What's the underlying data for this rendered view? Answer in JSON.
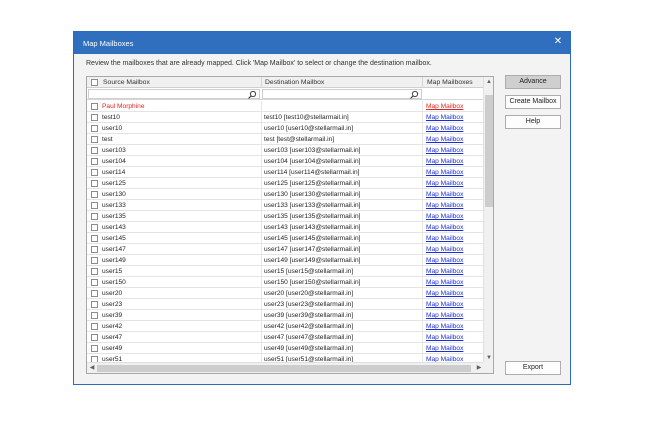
{
  "window": {
    "title": "Map Mailboxes",
    "close_glyph": "✕"
  },
  "instruction": "Review the mailboxes that are already mapped. Click 'Map Mailbox' to select or change the destination mailbox.",
  "columns": {
    "source": "Source Mailbox",
    "destination": "Destination Mailbox",
    "map": "Map Mailboxes"
  },
  "rows": [
    {
      "source": "Paul Morphine",
      "destination": "",
      "map": "Map Mailbox",
      "highlight": true
    },
    {
      "source": "test10",
      "destination": "test10 [test10@stellarmail.in]",
      "map": "Map Mailbox"
    },
    {
      "source": "user10",
      "destination": "user10 [user10@stellarmail.in]",
      "map": "Map Mailbox"
    },
    {
      "source": "test",
      "destination": "test [test@stellarmail.in]",
      "map": "Map Mailbox"
    },
    {
      "source": "user103",
      "destination": "user103 [user103@stellarmail.in]",
      "map": "Map Mailbox"
    },
    {
      "source": "user104",
      "destination": "user104 [user104@stellarmail.in]",
      "map": "Map Mailbox"
    },
    {
      "source": "user114",
      "destination": "user114 [user114@stellarmail.in]",
      "map": "Map Mailbox"
    },
    {
      "source": "user125",
      "destination": "user125 [user125@stellarmail.in]",
      "map": "Map Mailbox"
    },
    {
      "source": "user130",
      "destination": "user130 [user130@stellarmail.in]",
      "map": "Map Mailbox"
    },
    {
      "source": "user133",
      "destination": "user133 [user133@stellarmail.in]",
      "map": "Map Mailbox"
    },
    {
      "source": "user135",
      "destination": "user135 [user135@stellarmail.in]",
      "map": "Map Mailbox"
    },
    {
      "source": "user143",
      "destination": "user143 [user143@stellarmail.in]",
      "map": "Map Mailbox"
    },
    {
      "source": "user145",
      "destination": "user145 [user145@stellarmail.in]",
      "map": "Map Mailbox"
    },
    {
      "source": "user147",
      "destination": "user147 [user147@stellarmail.in]",
      "map": "Map Mailbox"
    },
    {
      "source": "user149",
      "destination": "user149 [user149@stellarmail.in]",
      "map": "Map Mailbox"
    },
    {
      "source": "user15",
      "destination": "user15 [user15@stellarmail.in]",
      "map": "Map Mailbox"
    },
    {
      "source": "user150",
      "destination": "user150 [user150@stellarmail.in]",
      "map": "Map Mailbox"
    },
    {
      "source": "user20",
      "destination": "user20 [user20@stellarmail.in]",
      "map": "Map Mailbox"
    },
    {
      "source": "user23",
      "destination": "user23 [user23@stellarmail.in]",
      "map": "Map Mailbox"
    },
    {
      "source": "user39",
      "destination": "user39 [user39@stellarmail.in]",
      "map": "Map Mailbox"
    },
    {
      "source": "user42",
      "destination": "user42 [user42@stellarmail.in]",
      "map": "Map Mailbox"
    },
    {
      "source": "user47",
      "destination": "user47 [user47@stellarmail.in]",
      "map": "Map Mailbox"
    },
    {
      "source": "user49",
      "destination": "user49 [user49@stellarmail.in]",
      "map": "Map Mailbox"
    },
    {
      "source": "user51",
      "destination": "user51 [user51@stellarmail.in]",
      "map": "Map Mailbox"
    }
  ],
  "buttons": {
    "advance": "Advance",
    "create_mailbox": "Create Mailbox",
    "help": "Help",
    "export": "Export"
  },
  "icons": {
    "filter_search": "search-icon",
    "scroll_up": "▲",
    "scroll_down": "▼",
    "scroll_left": "◀",
    "scroll_right": "▶"
  },
  "colors": {
    "titlebar": "#2f6fbd",
    "link": "#1a2fd6",
    "highlight_text": "#e0261e"
  }
}
